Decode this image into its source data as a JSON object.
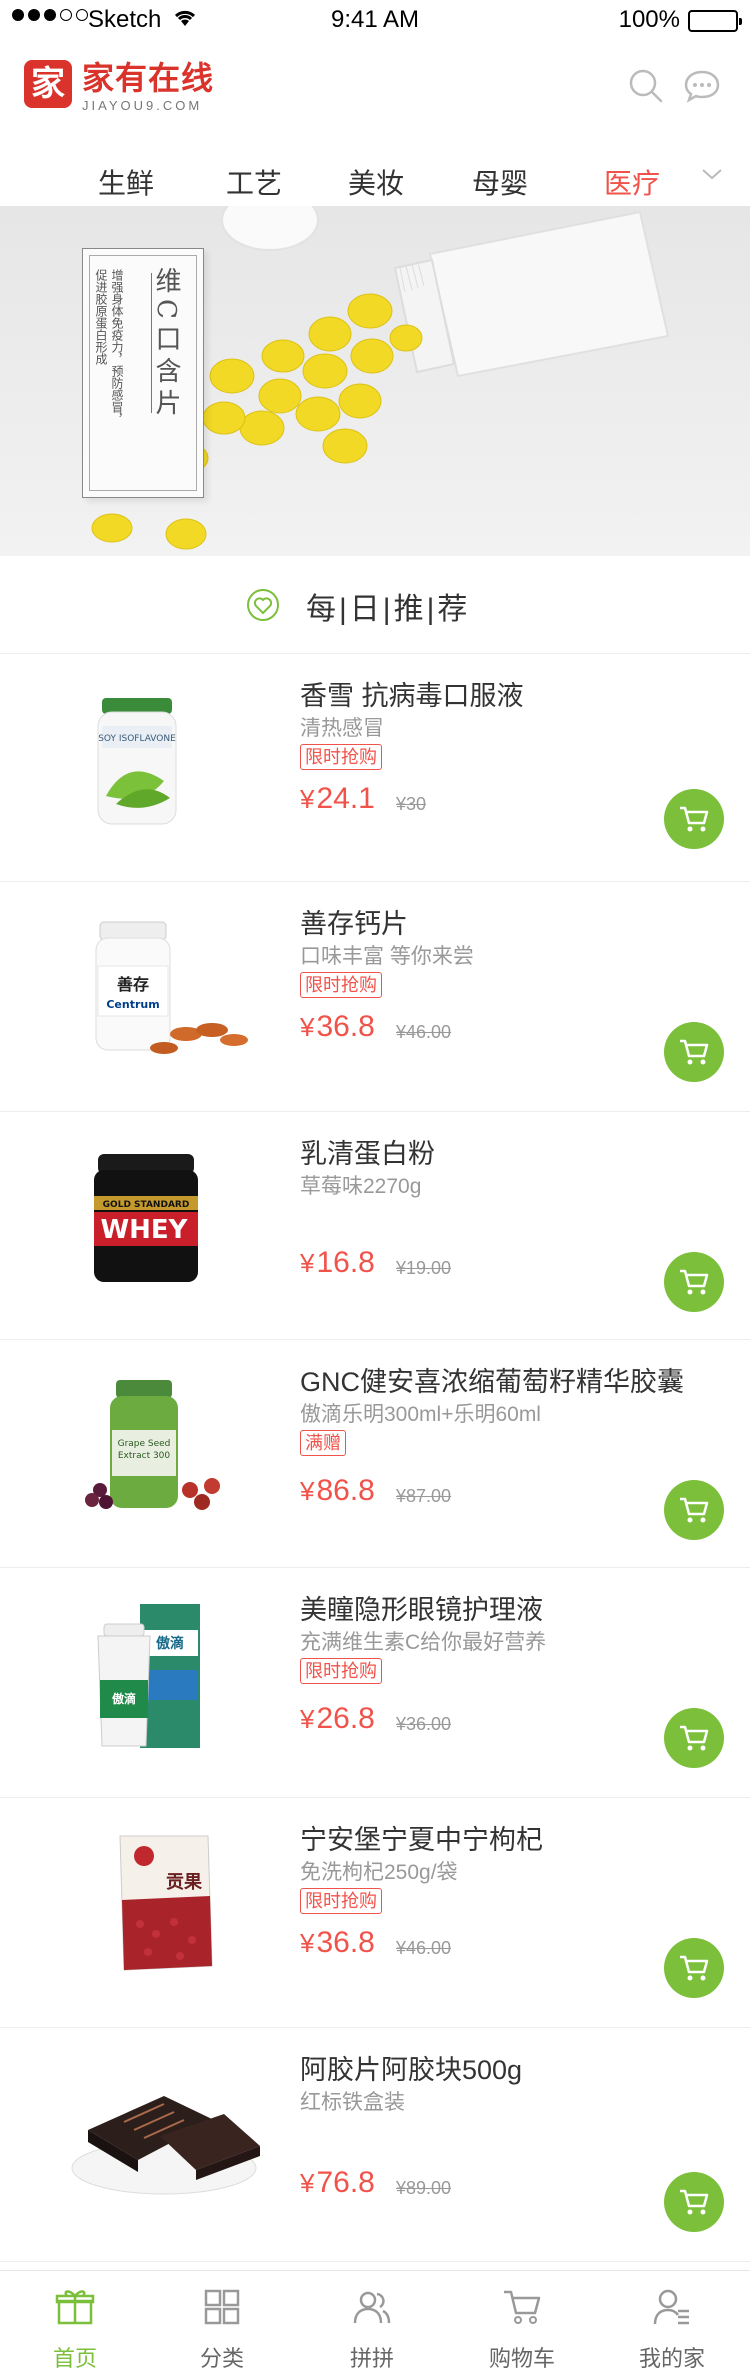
{
  "status_bar": {
    "carrier": "Sketch",
    "time": "9:41 AM",
    "battery": "100%"
  },
  "header": {
    "logo_mark": "家",
    "logo_name": "家有在线",
    "logo_domain": "JIAYOU9.COM",
    "search_icon": "search-icon",
    "message_icon": "chat-bubble-icon"
  },
  "tabs": {
    "items": [
      "生鲜",
      "工艺",
      "美妆",
      "母婴",
      "医疗"
    ],
    "active_index": 4,
    "expand_icon": "chevron-down-icon"
  },
  "banner": {
    "title": "维C口含片",
    "description": "增强身体免疫力，预防感冒，促进胶原蛋白形成"
  },
  "daily": {
    "title": "每|日|推|荐",
    "icon": "heart-circle-icon"
  },
  "products": [
    {
      "name": "香雪 抗病毒口服液",
      "subtitle": "清热感冒",
      "tag": "限时抢购",
      "currency": "¥",
      "price": "24.1",
      "old_price": "¥30",
      "image": "supplement-bottle-image"
    },
    {
      "name": "善存钙片",
      "subtitle": "口味丰富 等你来尝",
      "tag": "限时抢购",
      "currency": "¥",
      "price": "36.8",
      "old_price": "¥46.00",
      "image": "calcium-bottle-image"
    },
    {
      "name": "乳清蛋白粉",
      "subtitle": "草莓味2270g",
      "tag": "",
      "currency": "¥",
      "price": "16.8",
      "old_price": "¥19.00",
      "image": "whey-tub-image"
    },
    {
      "name": "GNC健安喜浓缩葡萄籽精华胶囊",
      "subtitle": "傲滴乐明300ml+乐明60ml",
      "tag": "满赠",
      "currency": "¥",
      "price": "86.8",
      "old_price": "¥87.00",
      "image": "grape-seed-bottle-image"
    },
    {
      "name": "美瞳隐形眼镜护理液",
      "subtitle": "充满维生素C给你最好营养",
      "tag": "限时抢购",
      "currency": "¥",
      "price": "26.8",
      "old_price": "¥36.00",
      "image": "lens-solution-image"
    },
    {
      "name": "宁安堡宁夏中宁枸杞",
      "subtitle": "免洗枸杞250g/袋",
      "tag": "限时抢购",
      "currency": "¥",
      "price": "36.8",
      "old_price": "¥46.00",
      "image": "goji-bag-image"
    },
    {
      "name": "阿胶片阿胶块500g",
      "subtitle": "红标铁盒装",
      "tag": "",
      "currency": "¥",
      "price": "76.8",
      "old_price": "¥89.00",
      "image": "ejiao-plate-image"
    }
  ],
  "bottom_nav": {
    "items": [
      "首页",
      "分类",
      "拼拼",
      "购物车",
      "我的家"
    ],
    "active_index": 0
  },
  "colors": {
    "brand_red": "#d9332b",
    "price_red": "#f0534a",
    "cart_green": "#7bbf3a"
  }
}
